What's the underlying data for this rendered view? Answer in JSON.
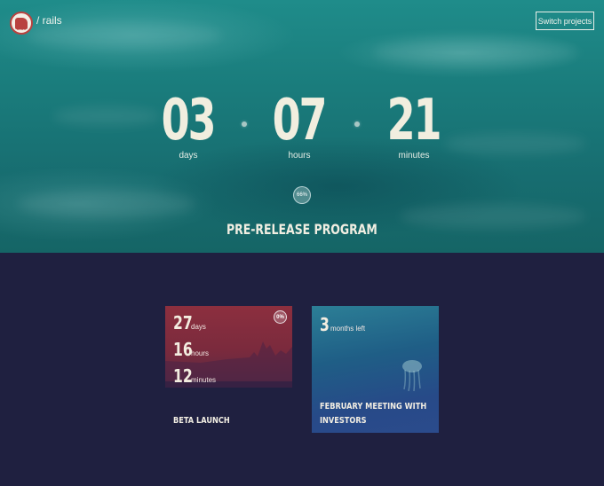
{
  "header": {
    "breadcrumb": "/ rails",
    "logo_text": "RAILS",
    "switch_button": "Switch projects"
  },
  "hero": {
    "countdown": [
      {
        "value": "03",
        "label": "days"
      },
      {
        "value": "07",
        "label": "hours"
      },
      {
        "value": "21",
        "label": "minutes"
      }
    ],
    "progress_badge": "66%",
    "progress": 0.66,
    "title": "PRE-RELEASE PROGRAM"
  },
  "cards": [
    {
      "title": "BETA LAUNCH",
      "badge": "0%",
      "rows": [
        {
          "value": "27",
          "unit": "days"
        },
        {
          "value": "16",
          "unit": "hours"
        },
        {
          "value": "12",
          "unit": "minutes"
        }
      ]
    },
    {
      "title_line1": "FEBRUARY MEETING WITH",
      "title_line2": "INVESTORS",
      "rows": [
        {
          "value": "3",
          "unit": "months left"
        }
      ]
    }
  ],
  "colors": {
    "hero_teal": "#1a7c7c",
    "page_navy": "#1f2040",
    "card_red": "#8c2f3e",
    "card_blue": "#274a88",
    "brand_red": "#b9423f"
  }
}
